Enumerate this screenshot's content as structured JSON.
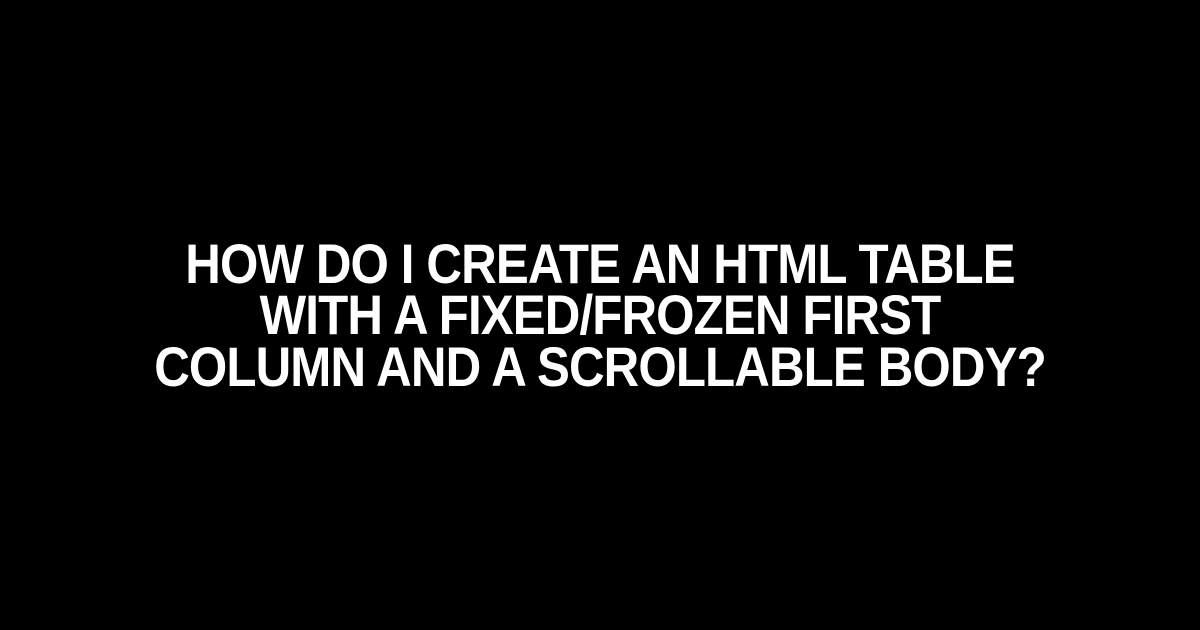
{
  "heading": "HOW DO I CREATE AN HTML TABLE WITH A FIXED/FROZEN FIRST COLUMN AND A SCROLLABLE BODY?"
}
